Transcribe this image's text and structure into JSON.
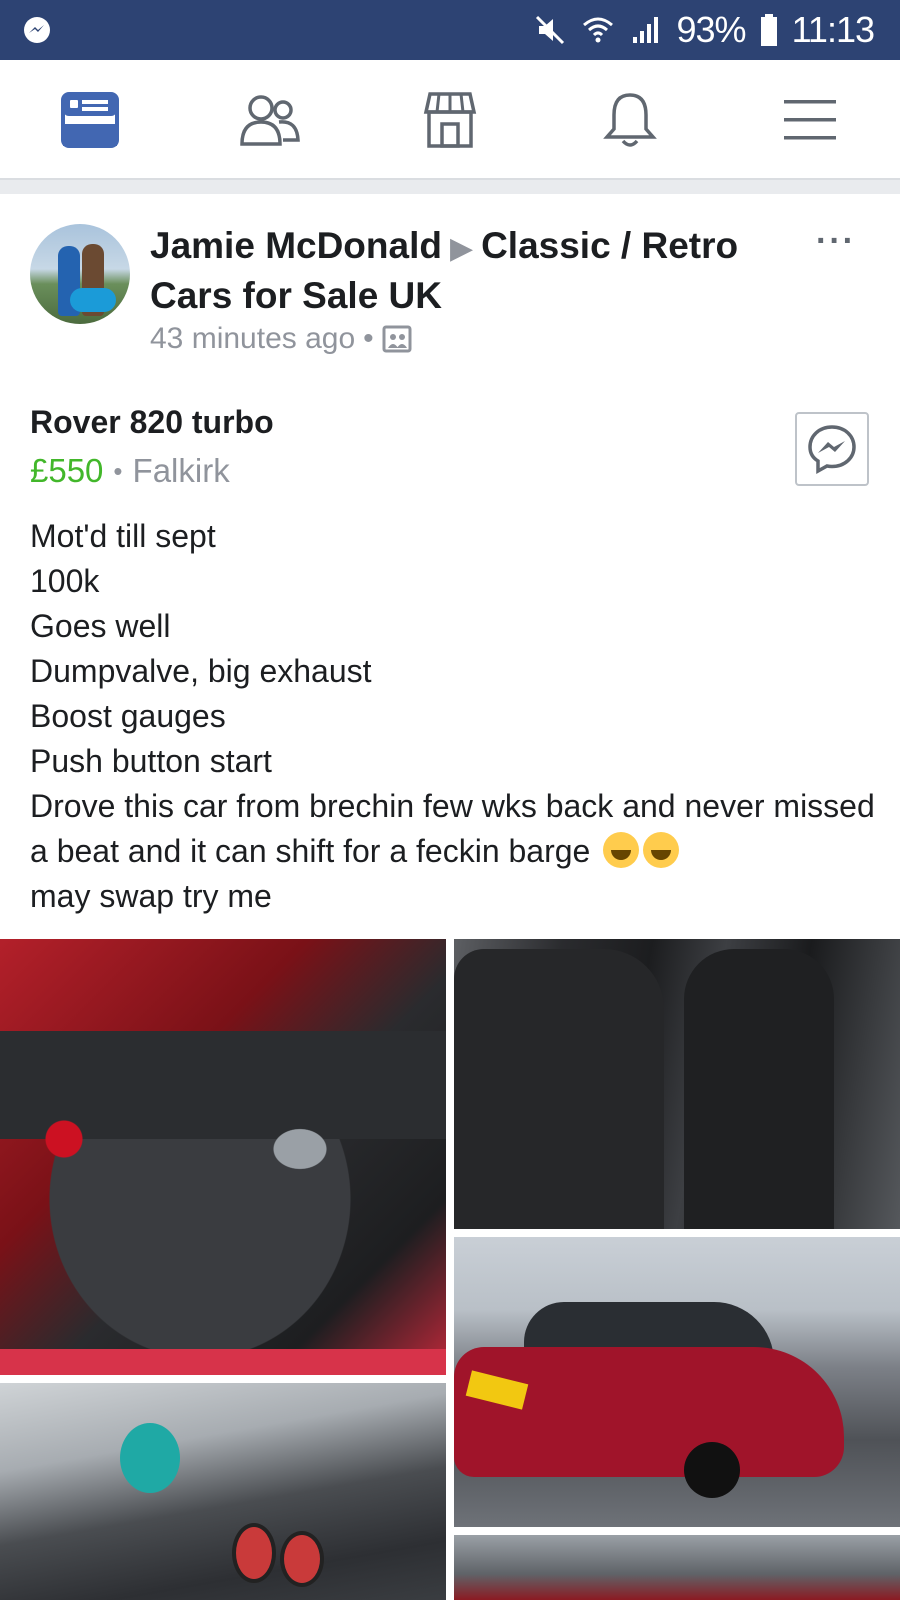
{
  "status_bar": {
    "battery_percent": "93%",
    "time": "11:13",
    "icons": [
      "messenger-icon",
      "mute-icon",
      "wifi-icon",
      "signal-icon",
      "battery-icon"
    ]
  },
  "nav": {
    "items": [
      {
        "name": "news-feed-icon",
        "active": true
      },
      {
        "name": "friends-icon",
        "active": false
      },
      {
        "name": "marketplace-icon",
        "active": false
      },
      {
        "name": "notifications-icon",
        "active": false
      },
      {
        "name": "menu-icon",
        "active": false
      }
    ],
    "active_color": "#4267b2",
    "inactive_color": "#606770"
  },
  "post": {
    "author": "Jamie McDonald",
    "group": "Classic / Retro Cars for Sale UK",
    "time": "43 minutes ago",
    "more_label": "···",
    "listing": {
      "title": "Rover 820 turbo",
      "price": "£550",
      "location": "Falkirk"
    },
    "body_lines": [
      "Mot'd till sept",
      "100k",
      "Goes well",
      "Dumpvalve, big exhaust",
      "Boost gauges",
      "Push button start"
    ],
    "body_paragraph": "Drove this car from brechin few wks back and never missed a beat and it can shift for a feckin barge",
    "body_tail": "may swap try me",
    "photos": [
      "engine-bay-photo",
      "recaro-seats-photo",
      "red-rover-car-photo",
      "dashboard-gauges-photo",
      "car-rear-photo"
    ]
  }
}
